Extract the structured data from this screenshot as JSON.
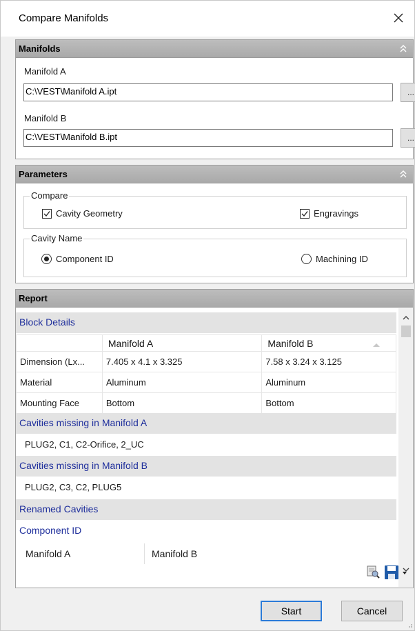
{
  "window": {
    "title": "Compare Manifolds"
  },
  "manifolds": {
    "header": "Manifolds",
    "a_label": "Manifold A",
    "a_path": "C:\\VEST\\Manifold A.ipt",
    "b_label": "Manifold B",
    "b_path": "C:\\VEST\\Manifold B.ipt",
    "browse_label": "..."
  },
  "parameters": {
    "header": "Parameters",
    "compare": {
      "legend": "Compare",
      "cavity_geometry": {
        "label": "Cavity Geometry",
        "checked": true
      },
      "engravings": {
        "label": "Engravings",
        "checked": true
      }
    },
    "cavity_name": {
      "legend": "Cavity Name",
      "component_id": {
        "label": "Component ID",
        "selected": true
      },
      "machining_id": {
        "label": "Machining ID",
        "selected": false
      }
    }
  },
  "report": {
    "header": "Report",
    "block_details": "Block Details",
    "columns": [
      "",
      "Manifold A",
      "Manifold B"
    ],
    "rows": [
      {
        "label": "Dimension (Lx...",
        "a": "7.405 x 4.1 x 3.325",
        "b": "7.58 x 3.24 x 3.125"
      },
      {
        "label": "Material",
        "a": "Aluminum",
        "b": "Aluminum"
      },
      {
        "label": "Mounting Face",
        "a": "Bottom",
        "b": "Bottom"
      }
    ],
    "missing_a_title": "Cavities missing in Manifold A",
    "missing_a_value": "PLUG2, C1, C2-Orifice, 2_UC",
    "missing_b_title": "Cavities missing in Manifold B",
    "missing_b_value": "PLUG2, C3, C2, PLUG5",
    "renamed_title": "Renamed Cavities",
    "component_id_title": "Component ID",
    "renamed_columns": [
      "Manifold A",
      "Manifold B"
    ]
  },
  "buttons": {
    "start": "Start",
    "cancel": "Cancel"
  },
  "colors": {
    "section_text": "#1f2f9c",
    "header_bg": "#b0b0b0",
    "save_icon": "#1e5aa8"
  }
}
